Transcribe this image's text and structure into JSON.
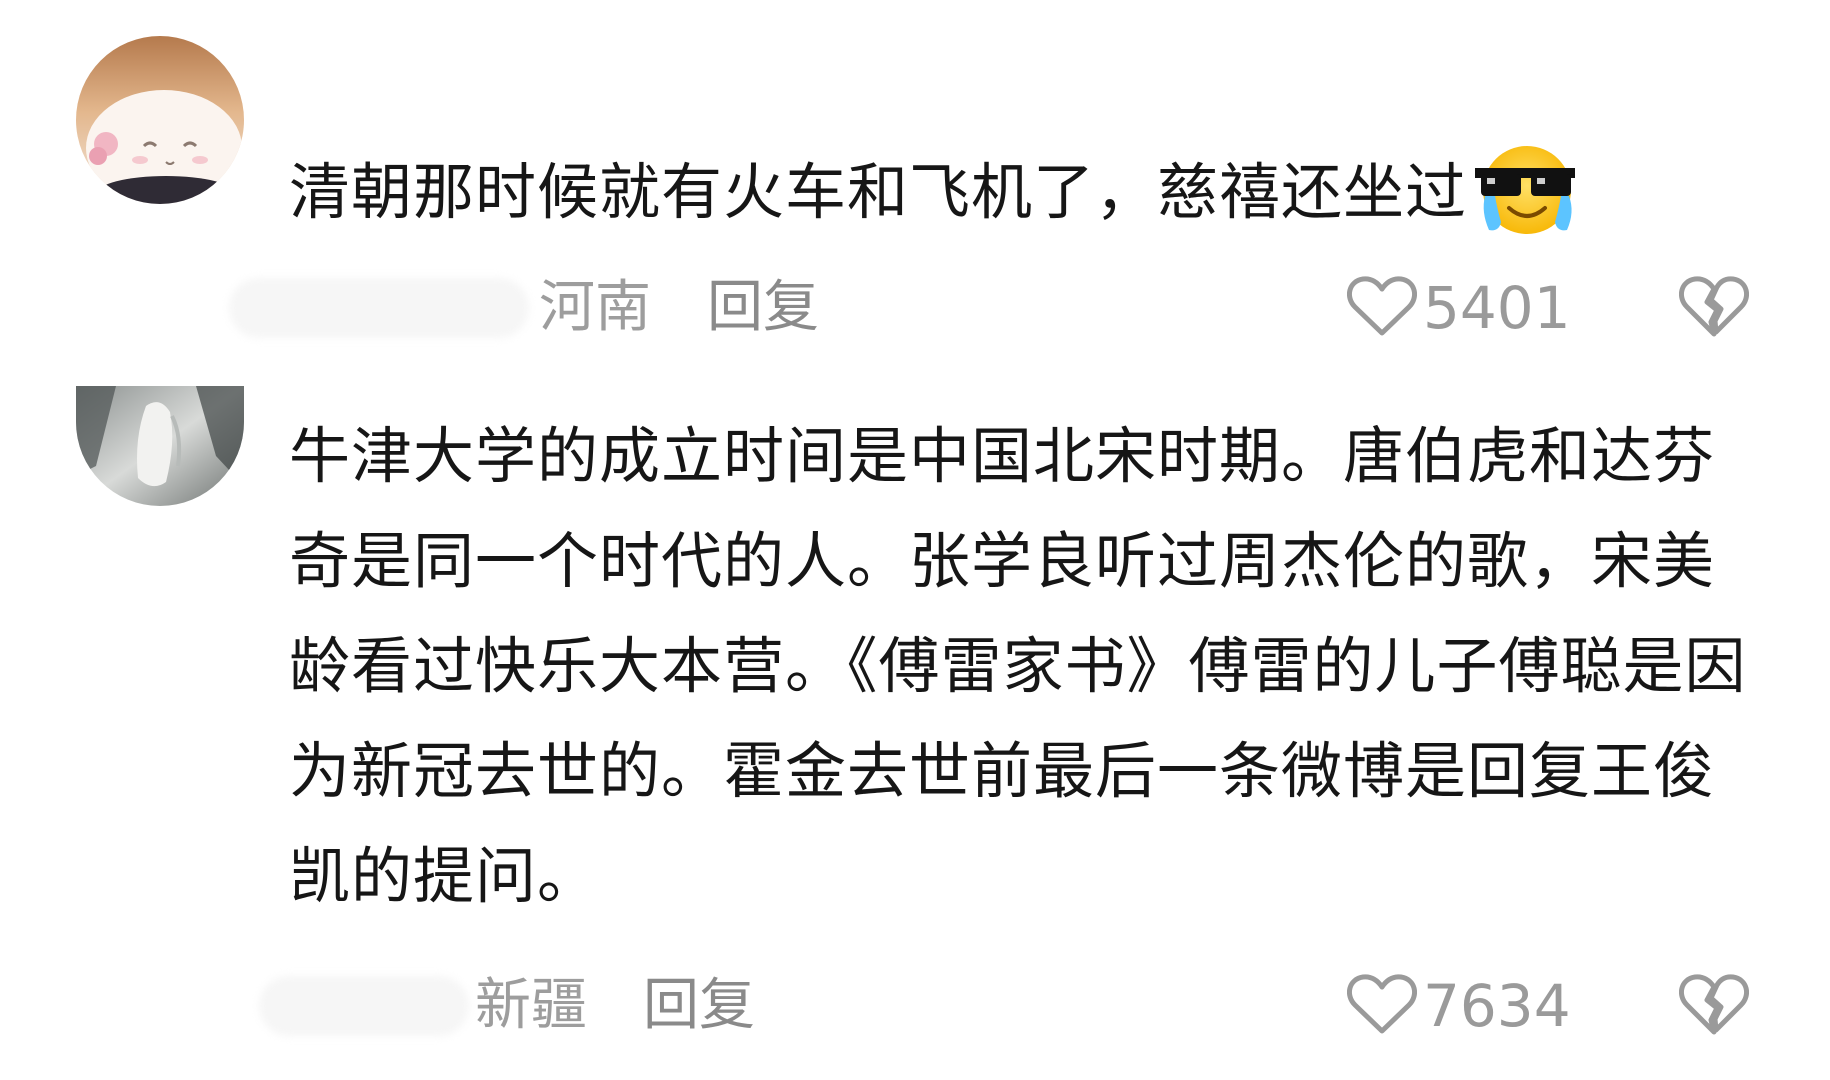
{
  "comments": [
    {
      "text": "清朝那时候就有火车和飞机了，慈禧还坐过",
      "emoji": "sunglasses-crying-emoji",
      "location": "河南",
      "reply_label": "回复",
      "likes": "5401"
    },
    {
      "text": "牛津大学的成立时间是中国北宋时期。唐伯虎和达芬奇是同一个时代的人。张学良听过周杰伦的歌，宋美龄看过快乐大本营。《傅雷家书》傅雷的儿子傅聪是因为新冠去世的。霍金去世前最后一条微博是回复王俊凯的提问。",
      "location": "新疆",
      "reply_label": "回复",
      "likes": "7634"
    }
  ],
  "icons": {
    "like": "heart-outline-icon",
    "dislike": "broken-heart-icon"
  },
  "colors": {
    "text": "#161616",
    "meta": "#9d9d9d",
    "icon": "#9a9a9a"
  }
}
